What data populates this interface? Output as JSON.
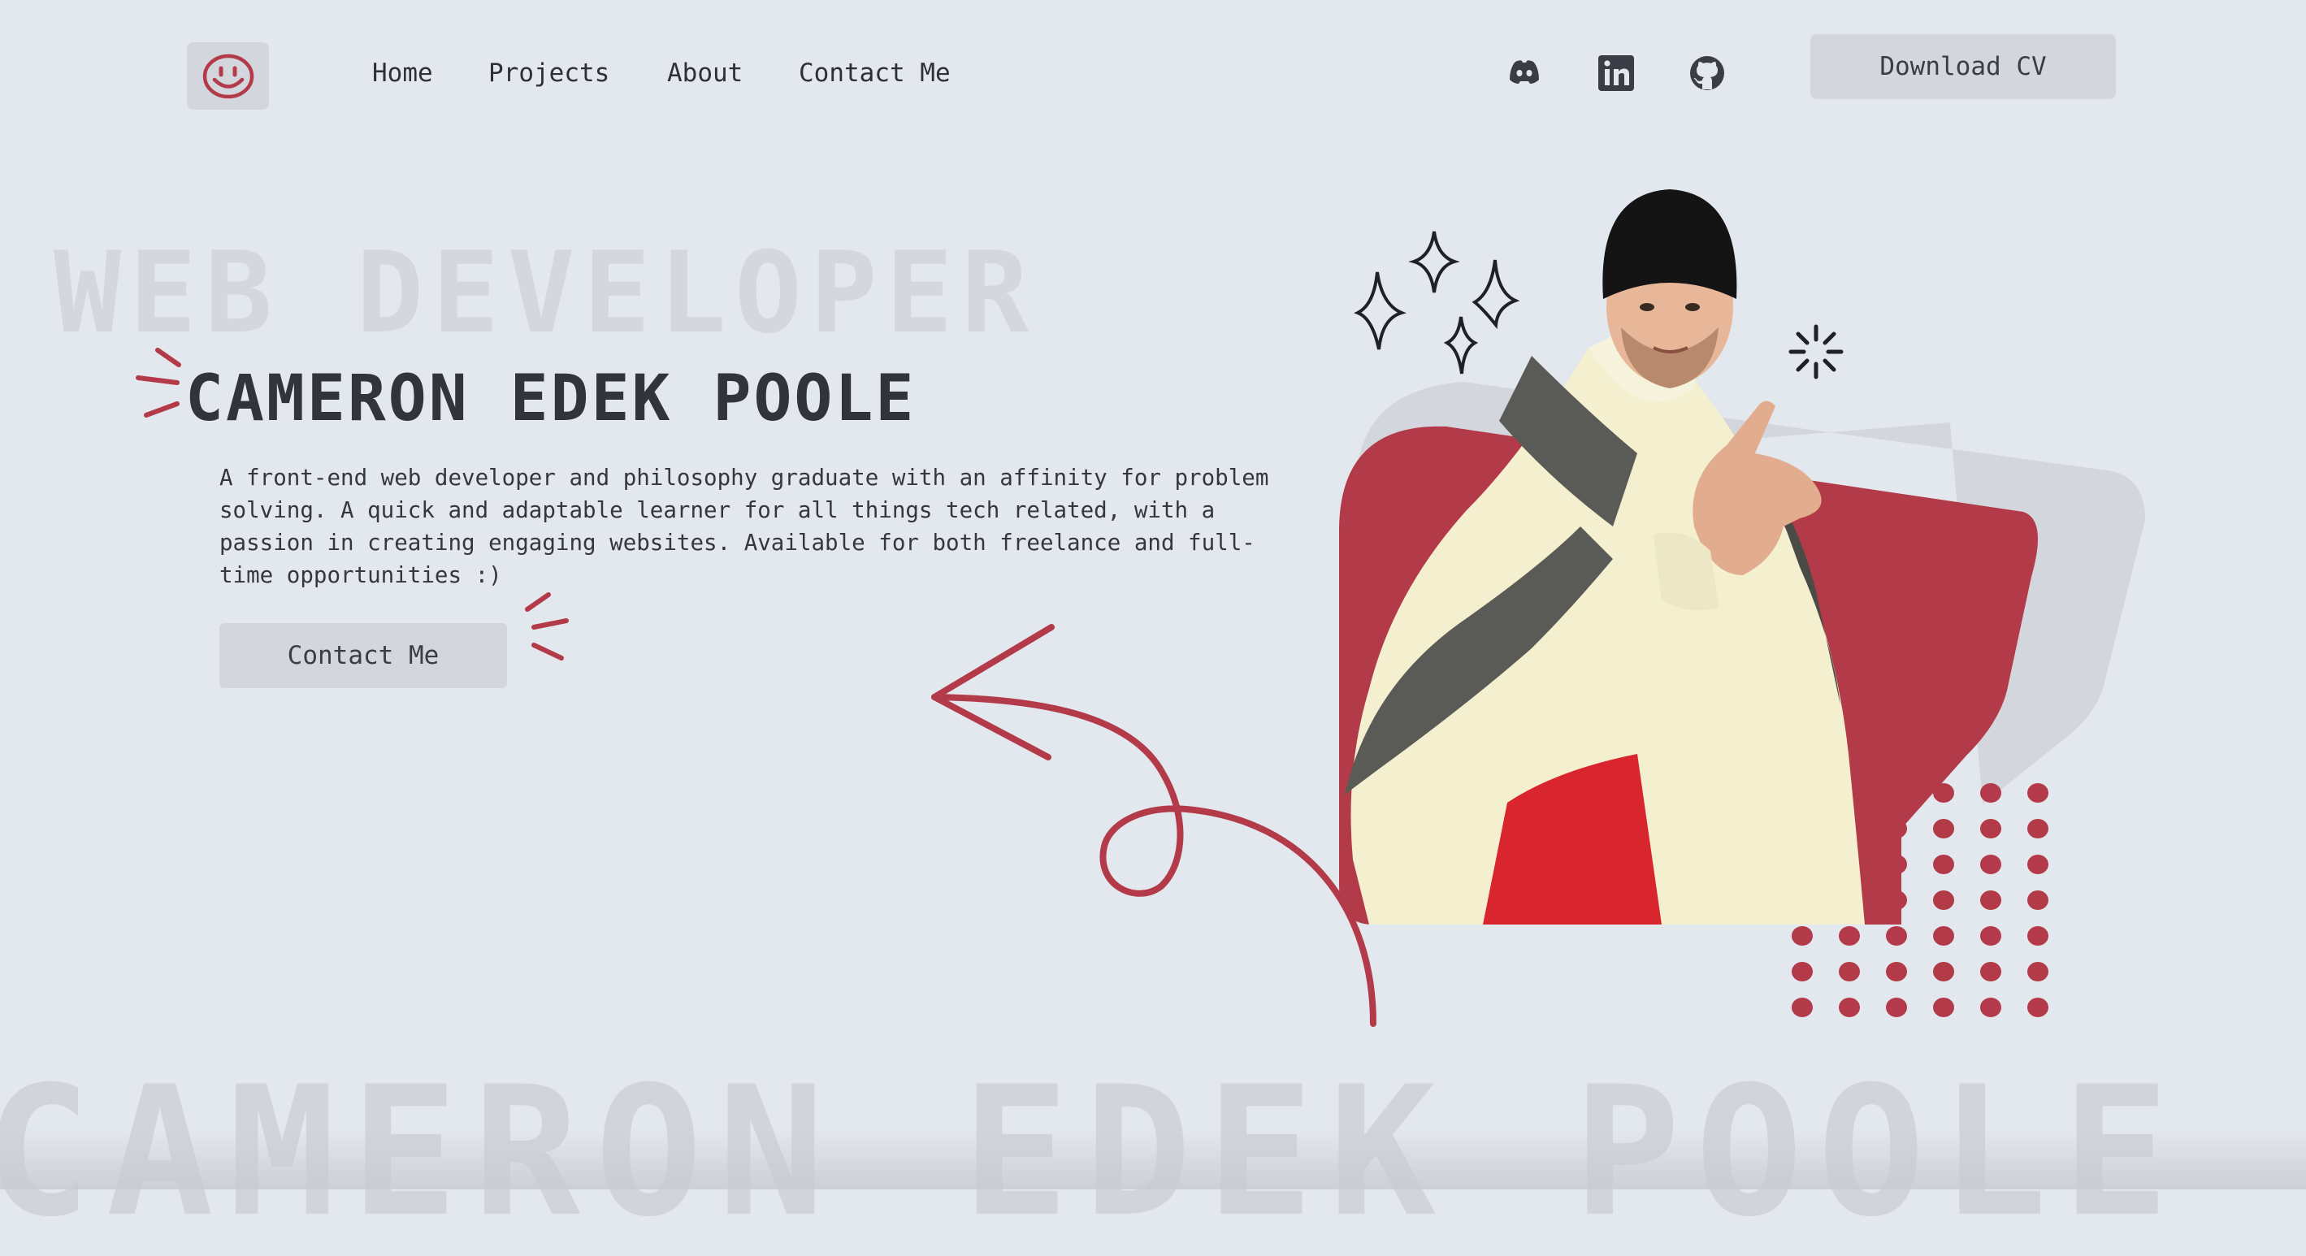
{
  "header": {
    "logo_icon": "smiley-face-icon",
    "nav": [
      {
        "label": "Home"
      },
      {
        "label": "Projects"
      },
      {
        "label": "About"
      },
      {
        "label": "Contact Me"
      }
    ],
    "social_icons": [
      "discord-icon",
      "linkedin-icon",
      "github-icon"
    ],
    "download_label": "Download CV"
  },
  "hero": {
    "background_role": "WEB DEVELOPER",
    "name": "CAMERON EDEK POOLE",
    "bio": "A front-end web developer and philosophy graduate with an affinity for problem solving. A quick and adaptable learner for all things tech related, with a passion in creating engaging websites. Available for both freelance and full-time opportunities :)",
    "contact_label": "Contact Me"
  },
  "background_name": "CAMERON EDEK POOLE",
  "colors": {
    "background": "#e3e7ee",
    "accent": "#b33a48",
    "button": "#d3d6dc",
    "text": "#2d3038"
  }
}
